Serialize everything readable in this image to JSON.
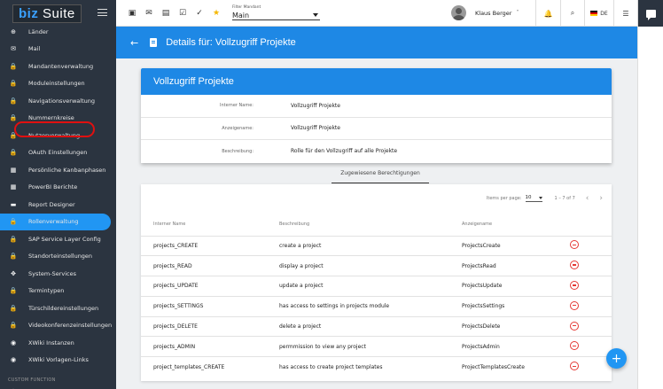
{
  "logo": {
    "brand": "biz",
    "name": "Suite"
  },
  "sidebar": {
    "items": [
      {
        "label": "Länder",
        "icon": "globe-icon",
        "glyph": "⊕"
      },
      {
        "label": "Mail",
        "icon": "mail-icon",
        "glyph": "✉"
      },
      {
        "label": "Mandantenverwaltung",
        "icon": "lock-icon",
        "glyph": "🔒"
      },
      {
        "label": "Moduleinstellungen",
        "icon": "lock-icon",
        "glyph": "🔒"
      },
      {
        "label": "Navigationsverwaltung",
        "icon": "lock-icon",
        "glyph": "🔒"
      },
      {
        "label": "Nummernkreise",
        "icon": "lock-icon",
        "glyph": "🔒"
      },
      {
        "label": "Nutzerverwaltung",
        "icon": "lock-icon",
        "glyph": "🔒"
      },
      {
        "label": "OAuth Einstellungen",
        "icon": "lock-icon",
        "glyph": "🔒"
      },
      {
        "label": "Persönliche Kanbanphasen",
        "icon": "kanban-icon",
        "glyph": "▦"
      },
      {
        "label": "PowerBI Berichte",
        "icon": "kanban-icon",
        "glyph": "▦"
      },
      {
        "label": "Report Designer",
        "icon": "file-icon",
        "glyph": "▬"
      },
      {
        "label": "Rollenverwaltung",
        "icon": "lock-icon",
        "glyph": "🔒",
        "active": true
      },
      {
        "label": "SAP Service Layer Config",
        "icon": "lock-icon",
        "glyph": "🔒"
      },
      {
        "label": "Standorteinstellungen",
        "icon": "lock-icon",
        "glyph": "🔒"
      },
      {
        "label": "System-Services",
        "icon": "services-icon",
        "glyph": "✥"
      },
      {
        "label": "Termintypen",
        "icon": "lock-icon",
        "glyph": "🔒"
      },
      {
        "label": "Türschildereinstellungen",
        "icon": "lock-icon",
        "glyph": "🔒"
      },
      {
        "label": "Videokonferenzeinstellungen",
        "icon": "lock-icon",
        "glyph": "🔒"
      },
      {
        "label": "XWiki Instanzen",
        "icon": "xwiki-icon",
        "glyph": "◉"
      },
      {
        "label": "XWiki Vorlagen-Links",
        "icon": "xwiki-icon",
        "glyph": "◉"
      }
    ],
    "section_label": "CUSTOM FUNCTION",
    "bottom_item": {
      "label": "Customize",
      "icon": "gear-icon",
      "glyph": "⚙"
    }
  },
  "topbar": {
    "filter_label": "Filter Mandant",
    "filter_value": "Main",
    "user_name": "Klaus Berger",
    "user_caret": "˅",
    "language": "DE"
  },
  "header": {
    "back_glyph": "←",
    "title": "Details für: Vollzugriff Projekte"
  },
  "details": {
    "title": "Vollzugriff Projekte",
    "rows": [
      {
        "label": "Interner Name:",
        "value": "Vollzugriff Projekte"
      },
      {
        "label": "Anzeigename:",
        "value": "Vollzugriff Projekte"
      },
      {
        "label": "Beschreibung:",
        "value": "Rolle für den Vollzugriff auf alle Projekte"
      }
    ]
  },
  "tab_label": "Zugewiesene Berechtigungen",
  "pager": {
    "items_per_page_label": "Items per page:",
    "items_per_page_value": "10",
    "range": "1 – 7 of 7",
    "prev_glyph": "‹",
    "next_glyph": "›"
  },
  "table": {
    "headers": [
      "Interner Name",
      "Beschreibung",
      "Anzeigename"
    ],
    "rows": [
      {
        "name": "projects_CREATE",
        "description": "create a project",
        "display": "ProjectsCreate"
      },
      {
        "name": "projects_READ",
        "description": "display a project",
        "display": "ProjectsRead"
      },
      {
        "name": "projects_UPDATE",
        "description": "update a project",
        "display": "ProjectsUpdate"
      },
      {
        "name": "projects_SETTINGS",
        "description": "has access to settings in projects module",
        "display": "ProjectsSettings"
      },
      {
        "name": "projects_DELETE",
        "description": "delete a project",
        "display": "ProjectsDelete"
      },
      {
        "name": "projects_ADMIN",
        "description": "permmission to view any project",
        "display": "ProjectsAdmin"
      },
      {
        "name": "project_templates_CREATE",
        "description": "has access to create project templates",
        "display": "ProjectTemplatesCreate"
      }
    ]
  },
  "fab_glyph": "+",
  "colors": {
    "accent": "#1e88e5",
    "sidebar_bg": "#2b3440",
    "danger": "#e53935",
    "highlight_ring": "#e01010"
  }
}
